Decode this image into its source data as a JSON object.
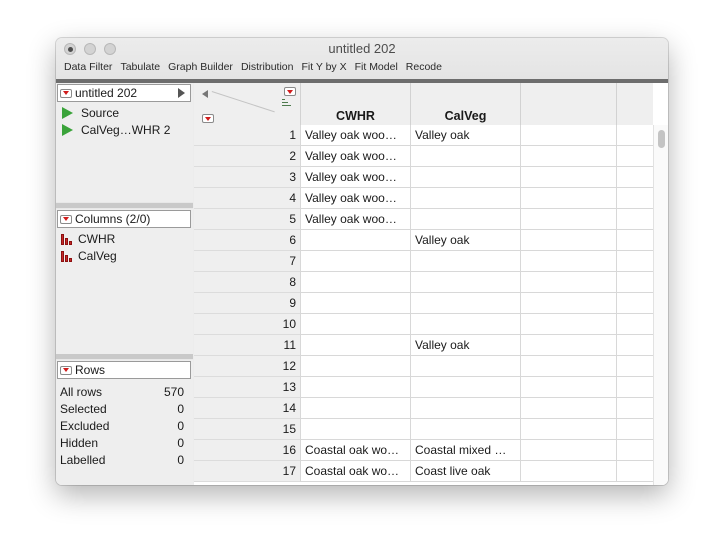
{
  "window": {
    "title": "untitled 202"
  },
  "toolbar": {
    "items": [
      "Data Filter",
      "Tabulate",
      "Graph Builder",
      "Distribution",
      "Fit Y by X",
      "Fit Model",
      "Recode"
    ]
  },
  "table_panel": {
    "title": "untitled 202",
    "items": [
      "Source",
      "CalVeg…WHR 2"
    ]
  },
  "columns_panel": {
    "title": "Columns (2/0)",
    "items": [
      "CWHR",
      "CalVeg"
    ]
  },
  "rows_panel": {
    "title": "Rows",
    "items": [
      {
        "label": "All rows",
        "value": "570"
      },
      {
        "label": "Selected",
        "value": "0"
      },
      {
        "label": "Excluded",
        "value": "0"
      },
      {
        "label": "Hidden",
        "value": "0"
      },
      {
        "label": "Labelled",
        "value": "0"
      }
    ]
  },
  "grid": {
    "columns": [
      "CWHR",
      "CalVeg",
      "",
      ""
    ],
    "rows": [
      {
        "n": "1",
        "cwhr": "Valley oak woo…",
        "calveg": "Valley oak"
      },
      {
        "n": "2",
        "cwhr": "Valley oak woo…",
        "calveg": ""
      },
      {
        "n": "3",
        "cwhr": "Valley oak woo…",
        "calveg": ""
      },
      {
        "n": "4",
        "cwhr": "Valley oak woo…",
        "calveg": ""
      },
      {
        "n": "5",
        "cwhr": "Valley oak woo…",
        "calveg": ""
      },
      {
        "n": "6",
        "cwhr": "",
        "calveg": "Valley oak"
      },
      {
        "n": "7",
        "cwhr": "",
        "calveg": ""
      },
      {
        "n": "8",
        "cwhr": "",
        "calveg": ""
      },
      {
        "n": "9",
        "cwhr": "",
        "calveg": ""
      },
      {
        "n": "10",
        "cwhr": "",
        "calveg": ""
      },
      {
        "n": "11",
        "cwhr": "",
        "calveg": "Valley oak"
      },
      {
        "n": "12",
        "cwhr": "",
        "calveg": ""
      },
      {
        "n": "13",
        "cwhr": "",
        "calveg": ""
      },
      {
        "n": "14",
        "cwhr": "",
        "calveg": ""
      },
      {
        "n": "15",
        "cwhr": "",
        "calveg": ""
      },
      {
        "n": "16",
        "cwhr": "Coastal oak wo…",
        "calveg": "Coastal mixed …"
      },
      {
        "n": "17",
        "cwhr": "Coastal oak wo…",
        "calveg": "Coast live oak"
      }
    ]
  }
}
